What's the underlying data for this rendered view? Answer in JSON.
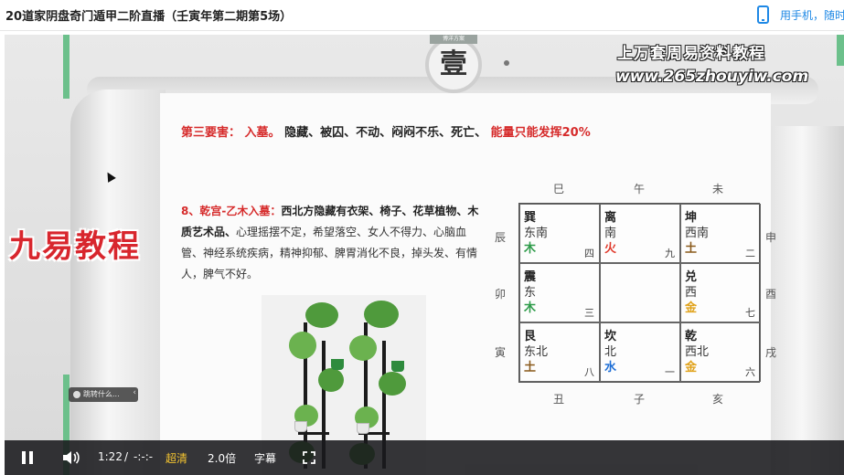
{
  "header": {
    "title": "20道家阴盘奇门遁甲二阶直播（壬寅年第二期第5场）",
    "phone_link": "用手机，随时"
  },
  "video": {
    "seal_char": "壹",
    "seal_tag": "博洋方案",
    "watermark_line1": "上万套周易资料教程",
    "watermark_line2": "www.265zhouyiw.com",
    "brand_overlay": "九易教程",
    "heading": {
      "prefix": "第三要害：",
      "key": "入墓。",
      "middle": "隐藏、被囚、不动、闷闷不乐、死亡、",
      "tail": "能量只能发挥20%"
    },
    "paragraph": {
      "title": "8、乾宫-乙木入墓：",
      "bold1": "西北方隐藏有衣架、椅子、花草植物、木质艺术品、",
      "rest": "心理摇摆不定，希望落空、女人不得力、心脑血管、神经系统疾病，精神抑郁、脾胃消化不良，掉头发、有情人，脾气不好。"
    },
    "toast_text": "跳转什么...",
    "toast_close": "‹"
  },
  "bagua": {
    "branches_top": [
      "巳",
      "午",
      "未"
    ],
    "branches_bottom": [
      "丑",
      "子",
      "亥"
    ],
    "branches_left": [
      "辰",
      "卯",
      "寅"
    ],
    "branches_right": [
      "申",
      "酉",
      "戌"
    ],
    "palaces": [
      {
        "name": "巽",
        "direction": "东南",
        "element": "木",
        "number": "四",
        "color": "#2e9b4a"
      },
      {
        "name": "离",
        "direction": "南",
        "element": "火",
        "number": "九",
        "color": "#e03a2c"
      },
      {
        "name": "坤",
        "direction": "西南",
        "element": "土",
        "number": "二",
        "color": "#8a5a1c"
      },
      {
        "name": "震",
        "direction": "东",
        "element": "木",
        "number": "三",
        "color": "#2e9b4a"
      },
      {
        "name": "",
        "direction": "",
        "element": "",
        "number": "",
        "color": "#333333"
      },
      {
        "name": "兑",
        "direction": "西",
        "element": "金",
        "number": "七",
        "color": "#e0a21a"
      },
      {
        "name": "艮",
        "direction": "东北",
        "element": "土",
        "number": "八",
        "color": "#8a5a1c"
      },
      {
        "name": "坎",
        "direction": "北",
        "element": "水",
        "number": "一",
        "color": "#1f6fd6"
      },
      {
        "name": "乾",
        "direction": "西北",
        "element": "金",
        "number": "六",
        "color": "#e0a21a"
      }
    ]
  },
  "player": {
    "time": "1:22",
    "separator": "/",
    "duration": "-:-:-",
    "quality": "超清",
    "speed": "2.0倍",
    "subtitles": "字幕",
    "quality_color": "#f4c430"
  }
}
